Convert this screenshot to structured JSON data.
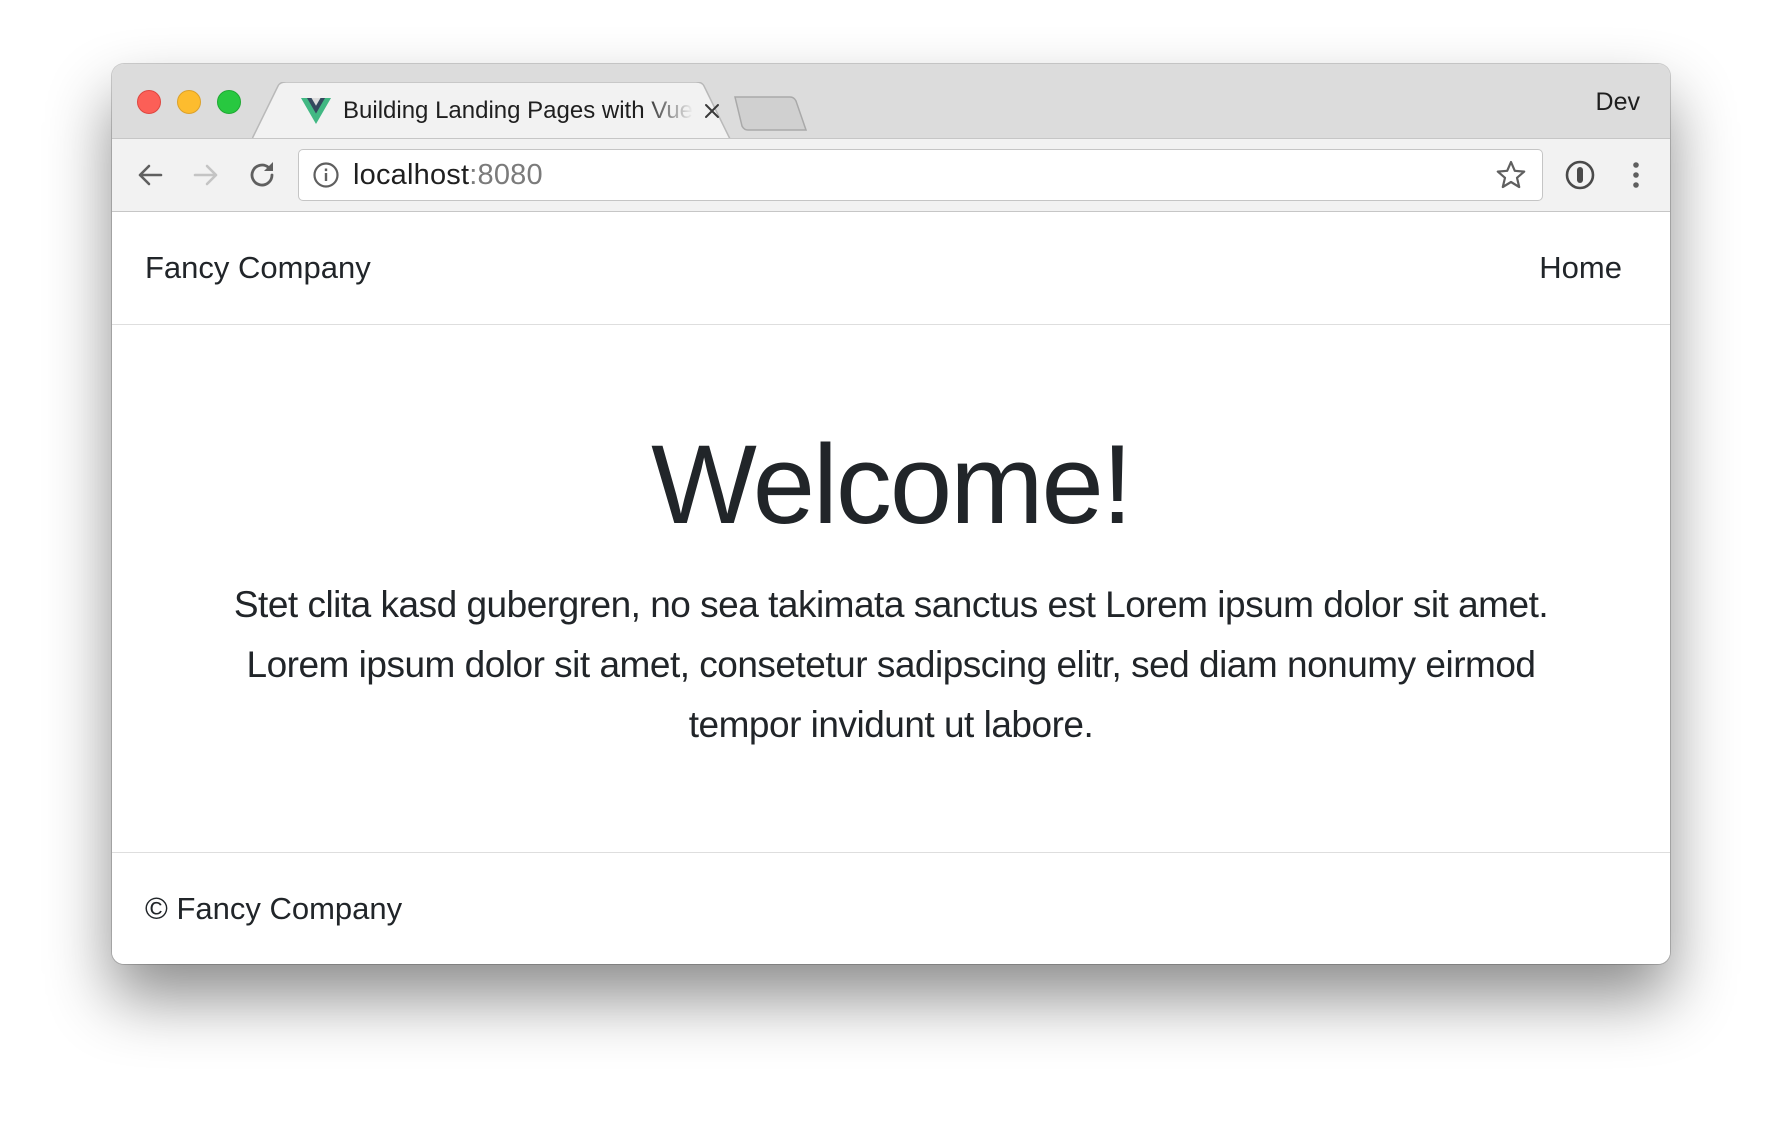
{
  "browser": {
    "tab": {
      "title": "Building Landing Pages with Vue.js",
      "favicon": "vue-logo-icon",
      "close_icon": "close-icon"
    },
    "new_tab_icon": "new-tab-icon",
    "profile_name": "Dev",
    "toolbar": {
      "back_icon": "arrow-left-icon",
      "forward_icon": "arrow-right-icon",
      "reload_icon": "reload-icon",
      "info_icon": "info-icon",
      "star_icon": "star-icon",
      "extension_icon": "password-manager-icon",
      "menu_icon": "vertical-dots-icon"
    },
    "address_bar": {
      "host": "localhost",
      "port": ":8080"
    }
  },
  "page": {
    "navbar": {
      "brand": "Fancy Company",
      "links": [
        "Home"
      ]
    },
    "hero": {
      "heading": "Welcome!",
      "paragraph": "Stet clita kasd gubergren, no sea takimata sanctus est Lorem ipsum dolor sit amet. Lorem ipsum dolor sit amet, consetetur sadipscing elitr, sed diam nonumy eirmod tempor invidunt ut labore."
    },
    "footer": {
      "text": "© Fancy Company"
    }
  },
  "colors": {
    "text": "#212529",
    "tabstrip": "#dcdcdc",
    "toolbar": "#f2f2f2",
    "traffic_red": "#fc5f57",
    "traffic_yellow": "#fdbc2e",
    "traffic_green": "#28c840",
    "vue_green": "#41b883",
    "vue_dark": "#34495e"
  }
}
